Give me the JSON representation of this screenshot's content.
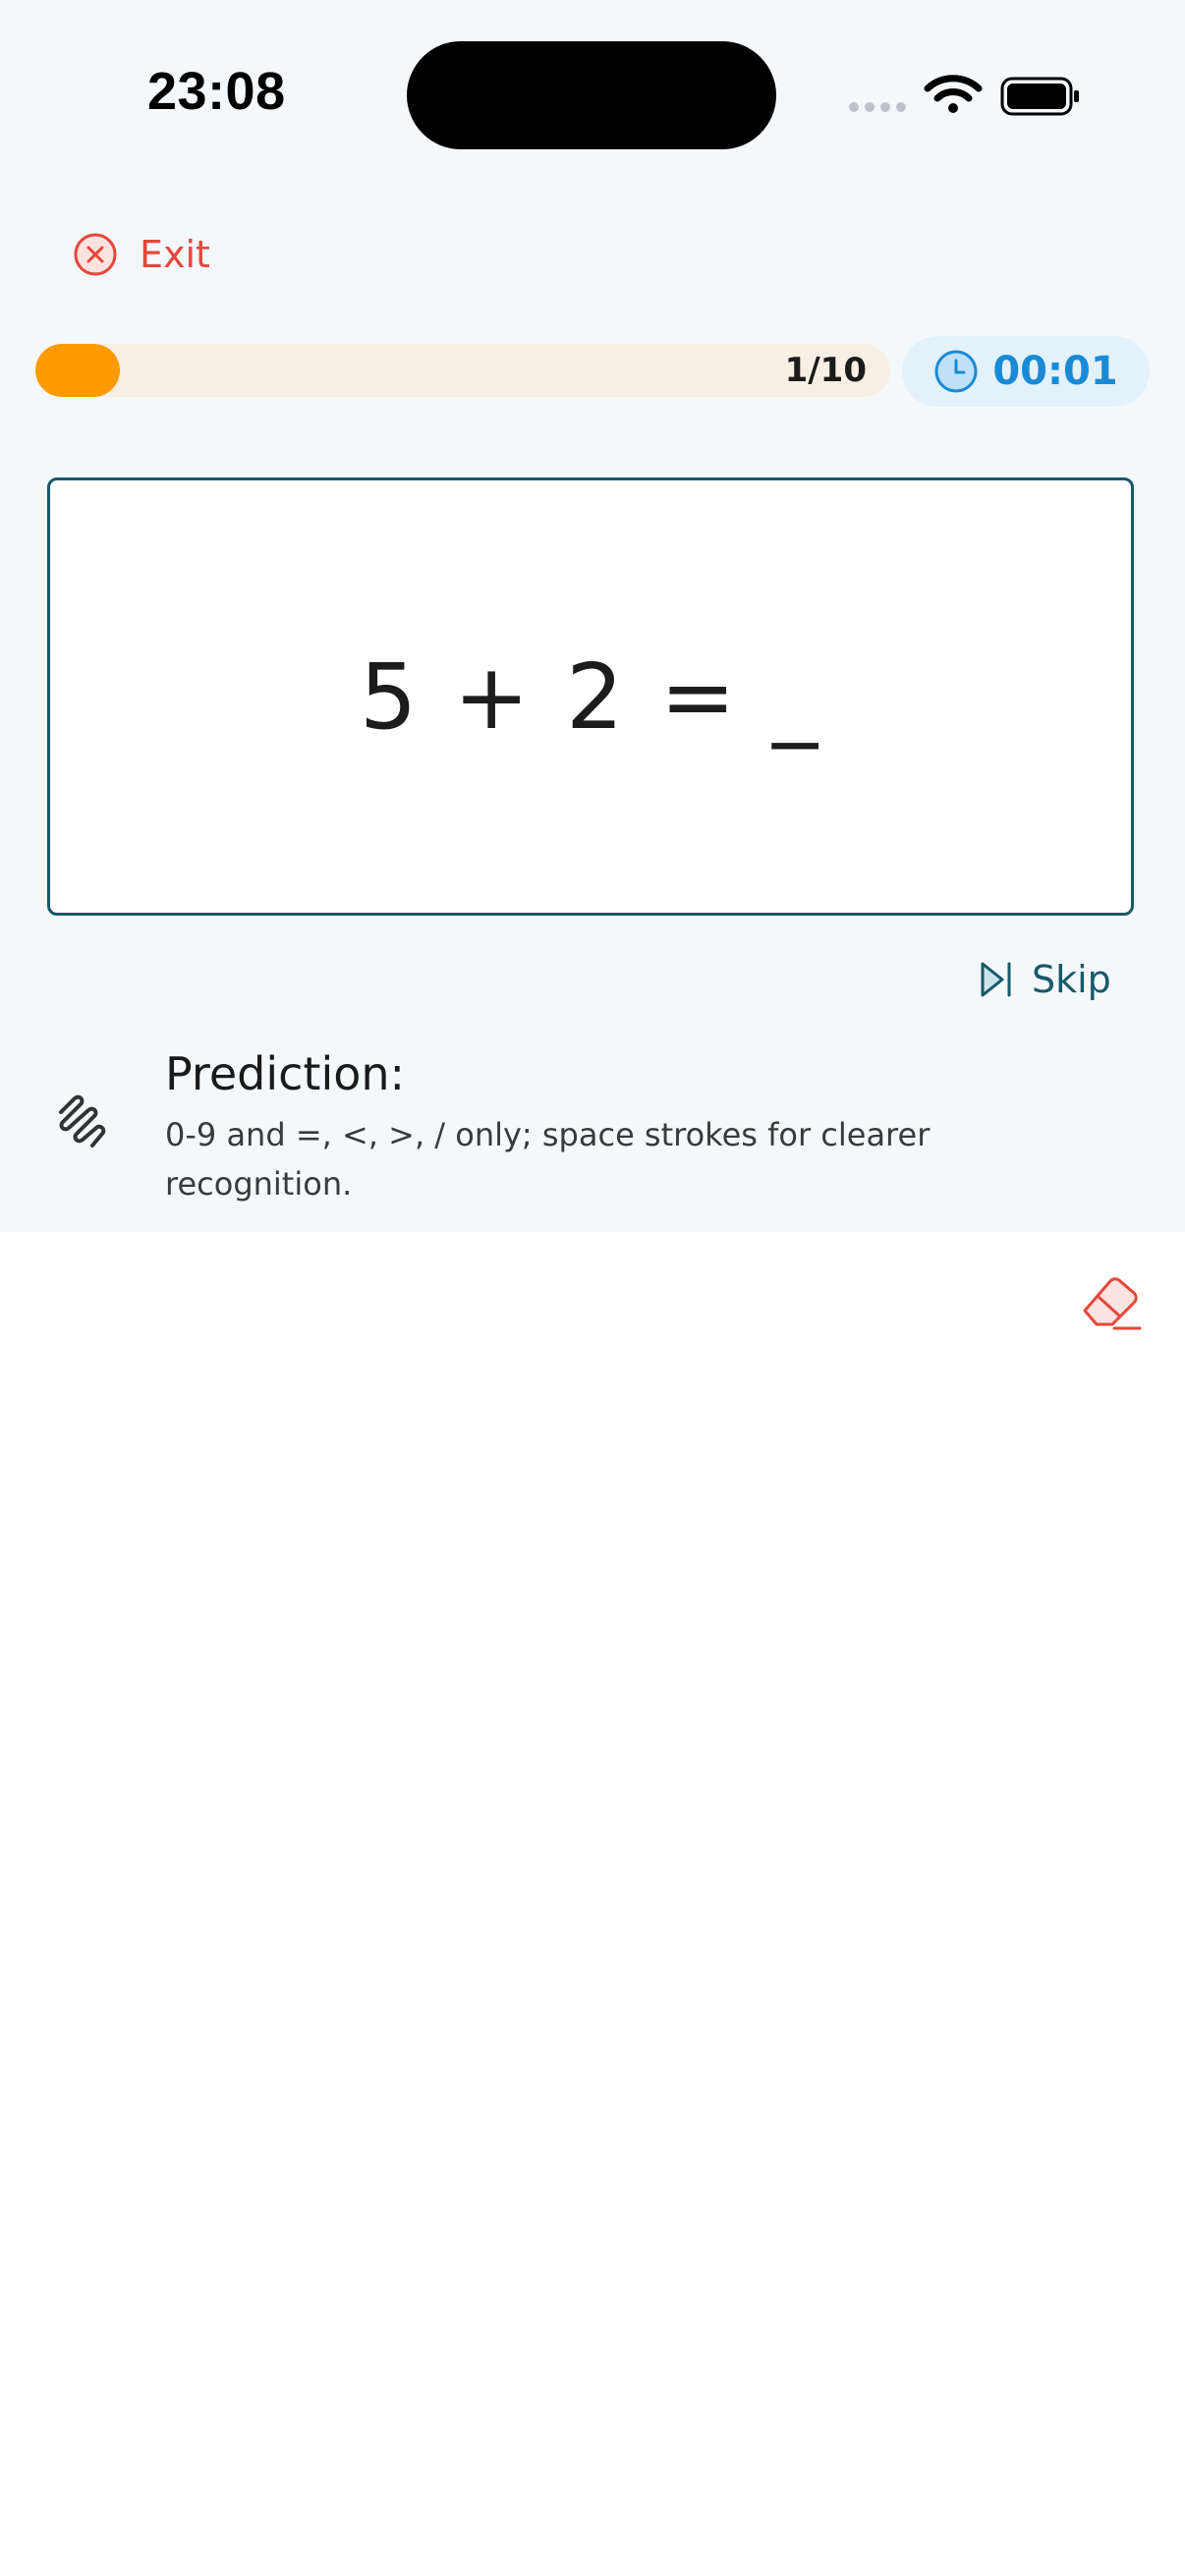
{
  "status_bar": {
    "time": "23:08"
  },
  "header": {
    "exit_label": "Exit"
  },
  "progress": {
    "label": "1/10",
    "current": 1,
    "total": 10
  },
  "timer": {
    "value": "00:01"
  },
  "question": {
    "text": "5 + 2 = _"
  },
  "skip": {
    "label": "Skip"
  },
  "prediction": {
    "title": "Prediction:",
    "hint": "0-9 and =, <, >, / only; space strokes for clearer recognition."
  },
  "icons": {
    "exit": "close-circle-icon",
    "timer": "clock-icon",
    "skip": "skip-icon",
    "prediction": "scribble-icon",
    "eraser": "eraser-icon"
  },
  "colors": {
    "accent_red": "#e4473b",
    "progress_fill": "#ff9a00",
    "progress_track": "#f6efe3",
    "timer_blue": "#1a8ad6",
    "timer_bg": "#e3f1fb",
    "teal": "#17596a"
  }
}
